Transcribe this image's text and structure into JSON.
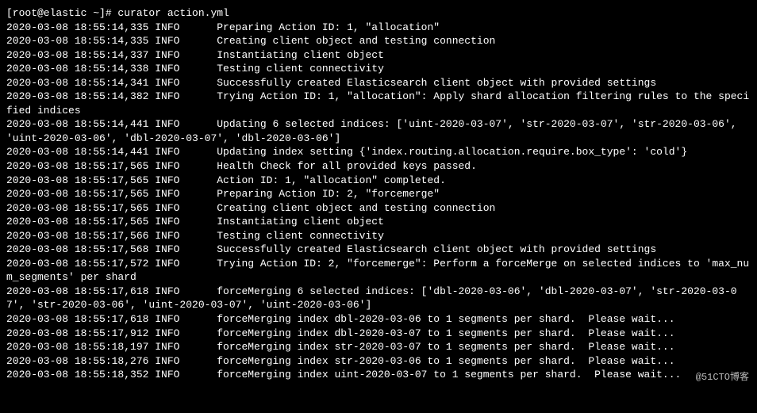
{
  "prompt": "[root@elastic ~]# curator action.yml",
  "lines": [
    "2020-03-08 18:55:14,335 INFO      Preparing Action ID: 1, \"allocation\"",
    "2020-03-08 18:55:14,335 INFO      Creating client object and testing connection",
    "2020-03-08 18:55:14,337 INFO      Instantiating client object",
    "2020-03-08 18:55:14,338 INFO      Testing client connectivity",
    "2020-03-08 18:55:14,341 INFO      Successfully created Elasticsearch client object with provided settings",
    "2020-03-08 18:55:14,382 INFO      Trying Action ID: 1, \"allocation\": Apply shard allocation filtering rules to the specified indices",
    "2020-03-08 18:55:14,441 INFO      Updating 6 selected indices: ['uint-2020-03-07', 'str-2020-03-07', 'str-2020-03-06', 'uint-2020-03-06', 'dbl-2020-03-07', 'dbl-2020-03-06']",
    "2020-03-08 18:55:14,441 INFO      Updating index setting {'index.routing.allocation.require.box_type': 'cold'}",
    "2020-03-08 18:55:17,565 INFO      Health Check for all provided keys passed.",
    "2020-03-08 18:55:17,565 INFO      Action ID: 1, \"allocation\" completed.",
    "2020-03-08 18:55:17,565 INFO      Preparing Action ID: 2, \"forcemerge\"",
    "2020-03-08 18:55:17,565 INFO      Creating client object and testing connection",
    "2020-03-08 18:55:17,565 INFO      Instantiating client object",
    "2020-03-08 18:55:17,566 INFO      Testing client connectivity",
    "2020-03-08 18:55:17,568 INFO      Successfully created Elasticsearch client object with provided settings",
    "2020-03-08 18:55:17,572 INFO      Trying Action ID: 2, \"forcemerge\": Perform a forceMerge on selected indices to 'max_num_segments' per shard",
    "2020-03-08 18:55:17,618 INFO      forceMerging 6 selected indices: ['dbl-2020-03-06', 'dbl-2020-03-07', 'str-2020-03-07', 'str-2020-03-06', 'uint-2020-03-07', 'uint-2020-03-06']",
    "2020-03-08 18:55:17,618 INFO      forceMerging index dbl-2020-03-06 to 1 segments per shard.  Please wait...",
    "2020-03-08 18:55:17,912 INFO      forceMerging index dbl-2020-03-07 to 1 segments per shard.  Please wait...",
    "2020-03-08 18:55:18,197 INFO      forceMerging index str-2020-03-07 to 1 segments per shard.  Please wait...",
    "2020-03-08 18:55:18,276 INFO      forceMerging index str-2020-03-06 to 1 segments per shard.  Please wait...",
    "2020-03-08 18:55:18,352 INFO      forceMerging index uint-2020-03-07 to 1 segments per shard.  Please wait..."
  ],
  "watermark": "@51CTO博客"
}
